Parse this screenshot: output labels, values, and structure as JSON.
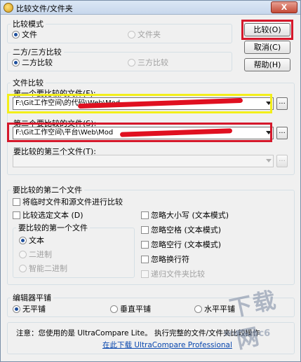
{
  "window": {
    "title": "比较文件/文件夹",
    "close_label": "X"
  },
  "compare_mode": {
    "legend": "比较模式",
    "options": [
      {
        "label": "文件",
        "checked": true,
        "enabled": true
      },
      {
        "label": "文件夹",
        "checked": false,
        "enabled": false
      }
    ]
  },
  "way_mode": {
    "legend": "二方/三方比较",
    "options": [
      {
        "label": "二方比较",
        "checked": true,
        "enabled": true
      },
      {
        "label": "三方比较",
        "checked": false,
        "enabled": false
      }
    ]
  },
  "buttons": {
    "compare": "比较(O)",
    "cancel": "取消(C)",
    "help": "帮助(H)"
  },
  "files": {
    "legend": "文件比较",
    "first_label": "第一个要比较的文件(F):",
    "first_value": "F:\\Git工作空间\\的代码\\Web\\Mod",
    "second_label": "第二个要比较的文件(S):",
    "second_value": "F:\\Git工作空间\\平台\\Web\\Mod",
    "third_label": "要比较的第三个文件(T):",
    "third_value": "",
    "browse": "..."
  },
  "second_file": {
    "legend": "要比较的第二个文件",
    "checks_left": [
      {
        "label": "将临时文件和源文件进行比较",
        "enabled": true
      },
      {
        "label": "比较选定文本 (D)",
        "enabled": true
      }
    ],
    "first_file_legend": "要比较的第一个文件",
    "first_file_options": [
      {
        "label": "文本",
        "checked": true,
        "enabled": true
      },
      {
        "label": "二进制",
        "checked": false,
        "enabled": false
      },
      {
        "label": "智能二进制",
        "checked": false,
        "enabled": false
      }
    ],
    "checks_right": [
      {
        "label": "忽略大小写 (文本模式)",
        "enabled": true
      },
      {
        "label": "忽略空格 (文本模式)",
        "enabled": true
      },
      {
        "label": "忽略空行 (文本模式)",
        "enabled": true
      },
      {
        "label": "忽略换行符",
        "enabled": true
      },
      {
        "label": "递归文件夹比较",
        "enabled": false
      }
    ]
  },
  "editor_tiling": {
    "legend": "编辑器平铺",
    "options": [
      {
        "label": "无平铺",
        "checked": true
      },
      {
        "label": "垂直平铺",
        "checked": false
      },
      {
        "label": "水平平铺",
        "checked": false
      }
    ]
  },
  "note": {
    "text": "注意：您使用的是 UltraCompare Lite。 执行完整的文件/文件夹比较操作",
    "link": "在此下载 UltraCompare Professional"
  },
  "watermark": {
    "brand": "下载网",
    "url": "www.pc6"
  },
  "colors": {
    "highlight_red": "#d5182b",
    "highlight_yellow": "#f3ef1a",
    "accent": "#1e4f9c"
  }
}
